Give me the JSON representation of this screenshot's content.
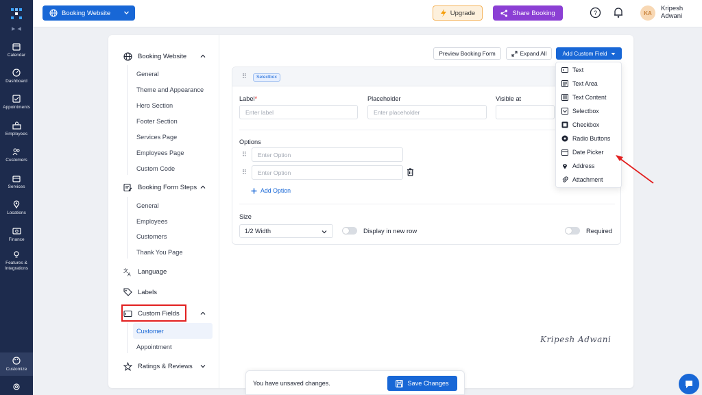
{
  "nav": {
    "items": [
      {
        "label": "Calendar",
        "icon": "calendar-icon"
      },
      {
        "label": "Dashboard",
        "icon": "dashboard-icon"
      },
      {
        "label": "Appointments",
        "icon": "appointments-icon"
      },
      {
        "label": "Employees",
        "icon": "employees-icon"
      },
      {
        "label": "Customers",
        "icon": "customers-icon"
      },
      {
        "label": "Services",
        "icon": "services-icon"
      },
      {
        "label": "Locations",
        "icon": "location-pin-icon"
      },
      {
        "label": "Finance",
        "icon": "finance-icon"
      },
      {
        "label": "Features & Integrations",
        "icon": "lightbulb-icon"
      },
      {
        "label": "Customize",
        "icon": "palette-icon"
      }
    ]
  },
  "topbar": {
    "site_select": "Booking Website",
    "upgrade": "Upgrade",
    "share": "Share Booking",
    "avatar_initials": "KA",
    "user_first": "Kripesh",
    "user_last": "Adwani"
  },
  "sidebar": {
    "booking_website": "Booking Website",
    "booking_website_items": [
      "General",
      "Theme and Appearance",
      "Hero Section",
      "Footer Section",
      "Services Page",
      "Employees Page",
      "Custom Code"
    ],
    "booking_form_steps": "Booking Form Steps",
    "booking_form_items": [
      "General",
      "Employees",
      "Customers",
      "Thank You Page"
    ],
    "language": "Language",
    "labels": "Labels",
    "custom_fields": "Custom Fields",
    "custom_fields_items": [
      "Customer",
      "Appointment"
    ],
    "ratings": "Ratings & Reviews"
  },
  "toolbar": {
    "preview": "Preview Booking Form",
    "expand": "Expand All",
    "add_custom_field": "Add Custom Field"
  },
  "field": {
    "type_tag": "Selectbox",
    "label_title": "Label",
    "label_required": "*",
    "label_placeholder": "Enter label",
    "placeholder_title": "Placeholder",
    "placeholder_placeholder": "Enter placeholder",
    "visible_at_title": "Visible at",
    "options_title": "Options",
    "option_placeholder": "Enter Option",
    "add_option": "Add Option",
    "size_title": "Size",
    "size_value": "1/2 Width",
    "display_new_row": "Display in new row",
    "required": "Required"
  },
  "dropdown": {
    "items": [
      {
        "label": "Text",
        "icon": "text-field-icon"
      },
      {
        "label": "Text Area",
        "icon": "text-area-icon"
      },
      {
        "label": "Text Content",
        "icon": "text-content-icon"
      },
      {
        "label": "Selectbox",
        "icon": "selectbox-icon"
      },
      {
        "label": "Checkbox",
        "icon": "checkbox-icon"
      },
      {
        "label": "Radio Buttons",
        "icon": "radio-icon"
      },
      {
        "label": "Date Picker",
        "icon": "calendar-icon"
      },
      {
        "label": "Address",
        "icon": "location-pin-icon"
      },
      {
        "label": "Attachment",
        "icon": "paperclip-icon"
      }
    ]
  },
  "toast": {
    "message": "You have unsaved changes.",
    "save": "Save Changes"
  },
  "signature": "Kripesh Adwani",
  "colors": {
    "nav_bg": "#1d2b4d",
    "primary": "#1867d6",
    "share": "#8b3fd4",
    "highlight": "#e21f1f"
  }
}
